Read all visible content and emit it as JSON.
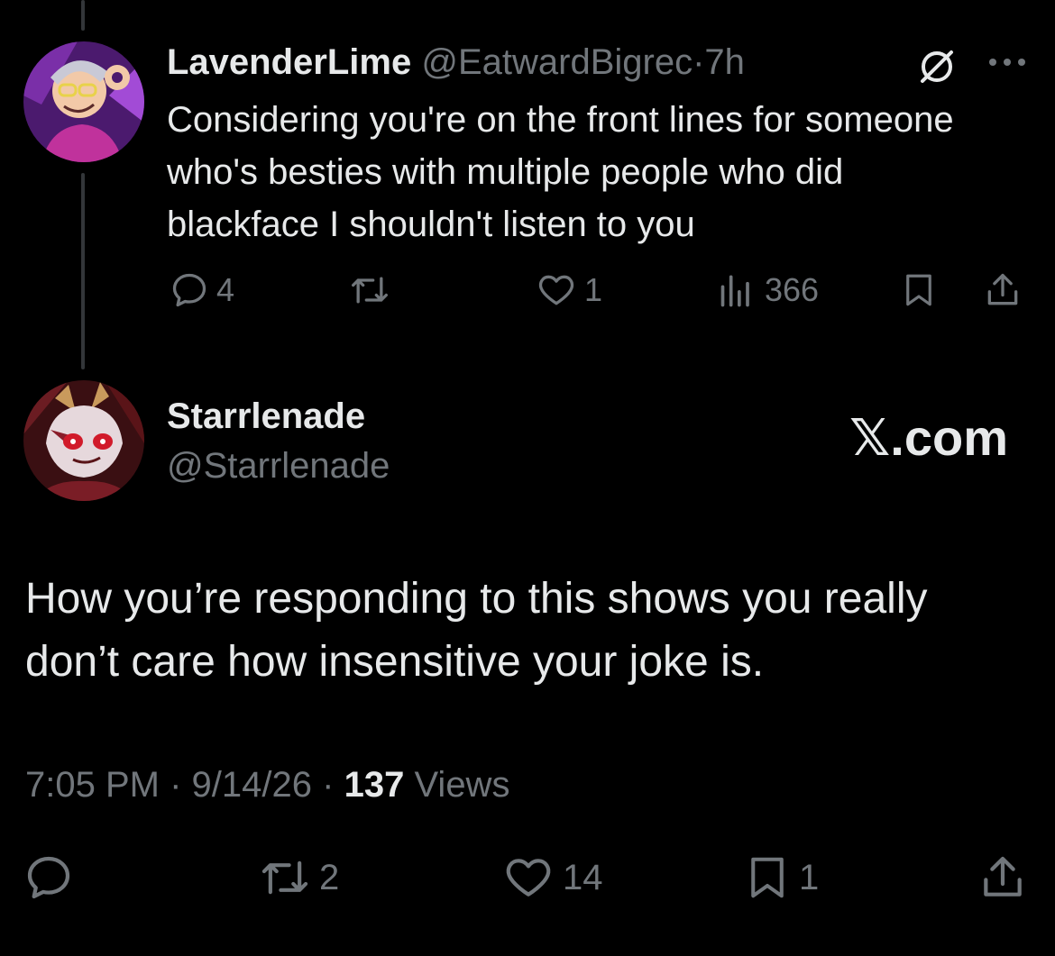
{
  "tweet1": {
    "display_name": "LavenderLime",
    "handle": "@EatwardBigrec",
    "separator": "·",
    "time": "7h",
    "body": "Considering you're on the front lines for someone who's besties with multiple people who did blackface I shouldn't listen to you",
    "actions": {
      "replies": "4",
      "retweets": "",
      "likes": "1",
      "views": "366"
    },
    "icons": [
      "mute-icon",
      "more-icon",
      "reply-icon",
      "retweet-icon",
      "like-icon",
      "views-icon",
      "bookmark-icon",
      "share-icon"
    ]
  },
  "tweet2": {
    "display_name": "Starrlenade",
    "handle": "@Starrlenade",
    "source_label": "𝕏.com",
    "body": "How you’re responding to this shows you really don’t care how insensitive your joke is.",
    "timestamp": "7:05 PM",
    "date": "9/14/26",
    "separator": "·",
    "views_count": "137",
    "views_label": "Views",
    "actions": {
      "retweets": "2",
      "likes": "14",
      "bookmarks": "1"
    }
  },
  "colors": {
    "background": "#000000",
    "text": "#e7e9ea",
    "muted": "#71767b",
    "thread_line": "#333639"
  }
}
